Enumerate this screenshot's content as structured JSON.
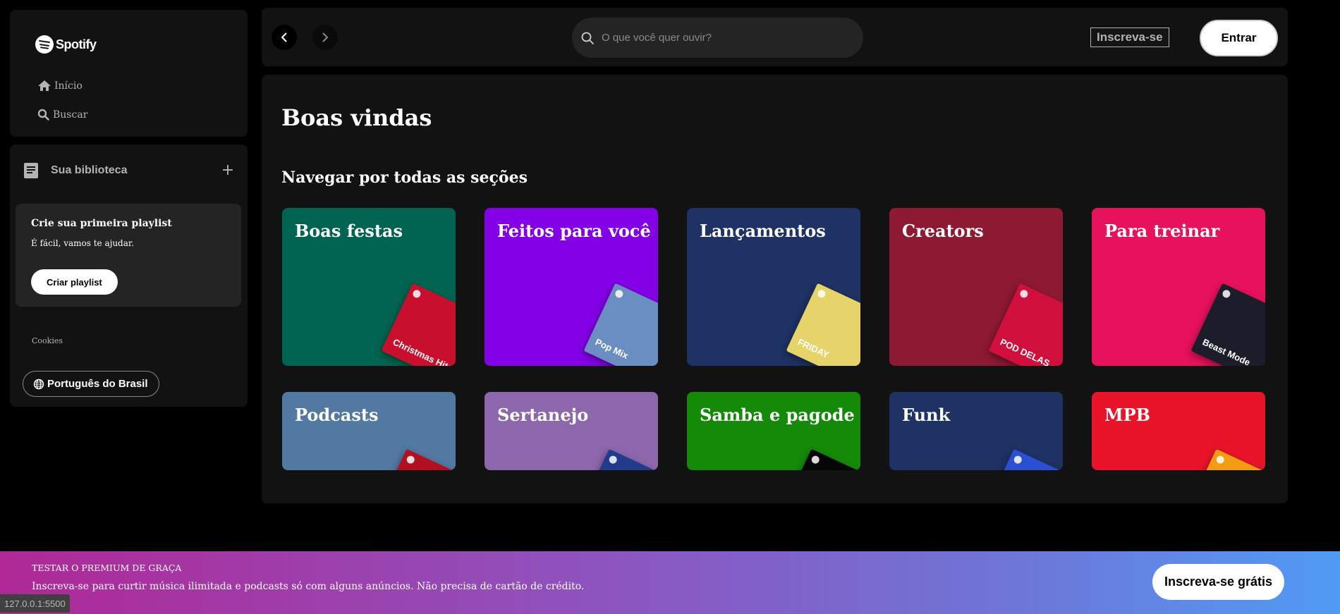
{
  "brand": {
    "name": "Spotify",
    "logo_icon": "spotify-logo-icon"
  },
  "nav": {
    "items": [
      {
        "label": "Início",
        "icon": "home-icon"
      },
      {
        "label": "Buscar",
        "icon": "search-icon"
      }
    ]
  },
  "library": {
    "title": "Sua biblioteca",
    "icon": "library-icon",
    "add_icon": "plus-icon",
    "create_card": {
      "title": "Crie sua primeira playlist",
      "subtitle": "É fácil, vamos te ajudar.",
      "button": "Criar playlist"
    },
    "cookies": "Cookies",
    "language_button": "Português do Brasil",
    "language_icon": "globe-icon"
  },
  "topbar": {
    "back_icon": "chevron-left-icon",
    "forward_icon": "chevron-right-icon",
    "search_placeholder": "O que você quer ouvir?",
    "signup": "Inscreva-se",
    "login": "Entrar"
  },
  "main": {
    "welcome": "Boas vindas",
    "section_title": "Navegar por todas as seções",
    "cards": [
      {
        "title": "Boas festas",
        "color": "#006450",
        "art_text": "Christmas Hits",
        "art_color": "#c8102e"
      },
      {
        "title": "Feitos para você",
        "color": "#8400e7",
        "art_text": "Pop Mix",
        "art_color": "#6a8ec2"
      },
      {
        "title": "Lançamentos",
        "color": "#1e3264",
        "art_text": "FRIDAY",
        "art_color": "#e6d36a"
      },
      {
        "title": "Creators",
        "color": "#8d1932",
        "art_text": "POD DELAS",
        "art_color": "#d10f3c"
      },
      {
        "title": "Para treinar",
        "color": "#e8115b",
        "art_text": "Beast Mode",
        "art_color": "#1c1c2a"
      },
      {
        "title": "Podcasts",
        "color": "#5179a1",
        "art_color": "#b01020"
      },
      {
        "title": "Sertanejo",
        "color": "#8d67ab",
        "art_color": "#203a8c"
      },
      {
        "title": "Samba e pagode",
        "color": "#148a08",
        "art_color": "#050505"
      },
      {
        "title": "Funk",
        "color": "#1e3264",
        "art_color": "#2a4fd0"
      },
      {
        "title": "MPB",
        "color": "#e91429",
        "art_color": "#f39c12"
      }
    ]
  },
  "banner": {
    "title": "TESTAR O PREMIUM DE GRAÇA",
    "subtitle": "Inscreva-se para curtir música ilimitada e podcasts só com alguns anúncios. Não precisa de cartão de crédito.",
    "button": "Inscreva-se grátis"
  },
  "status_url": "127.0.0.1:5500"
}
